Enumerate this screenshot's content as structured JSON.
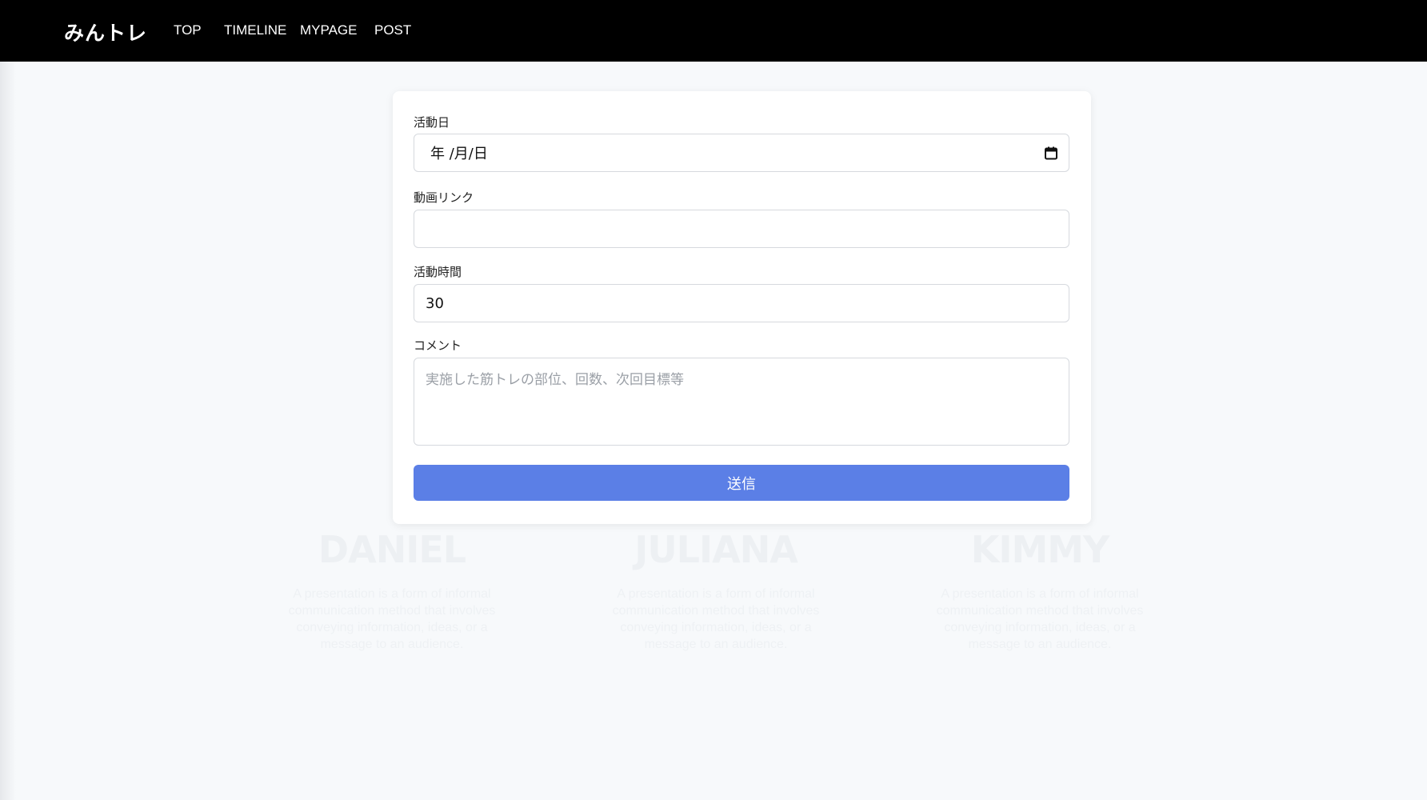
{
  "nav": {
    "brand": "みんトレ",
    "links": [
      "TOP",
      "TIMELINE",
      "MYPAGE",
      "POST"
    ]
  },
  "form": {
    "date_label": "活動日",
    "date_value": "年 /月/日",
    "video_label": "動画リンク",
    "video_value": "",
    "time_label": "活動時間",
    "time_value": "30",
    "comment_label": "コメント",
    "comment_placeholder": "実施した筋トレの部位、回数、次回目標等",
    "submit_label": "送信"
  },
  "background_cards": [
    {
      "name": "DANIEL",
      "text": "A presentation is a form of informal communication method that involves conveying information, ideas, or a message to an audience."
    },
    {
      "name": "JULIANA",
      "text": "A presentation is a form of informal communication method that involves conveying information, ideas, or a message to an audience."
    },
    {
      "name": "KIMMY",
      "text": "A presentation is a form of informal communication method that involves conveying information, ideas, or a message to an audience."
    }
  ],
  "colors": {
    "navbar": "#000000",
    "page_bg": "#f7f9fb",
    "submit_bg": "#5b7fe6"
  },
  "icons": {
    "date_picker": "calendar-icon"
  }
}
